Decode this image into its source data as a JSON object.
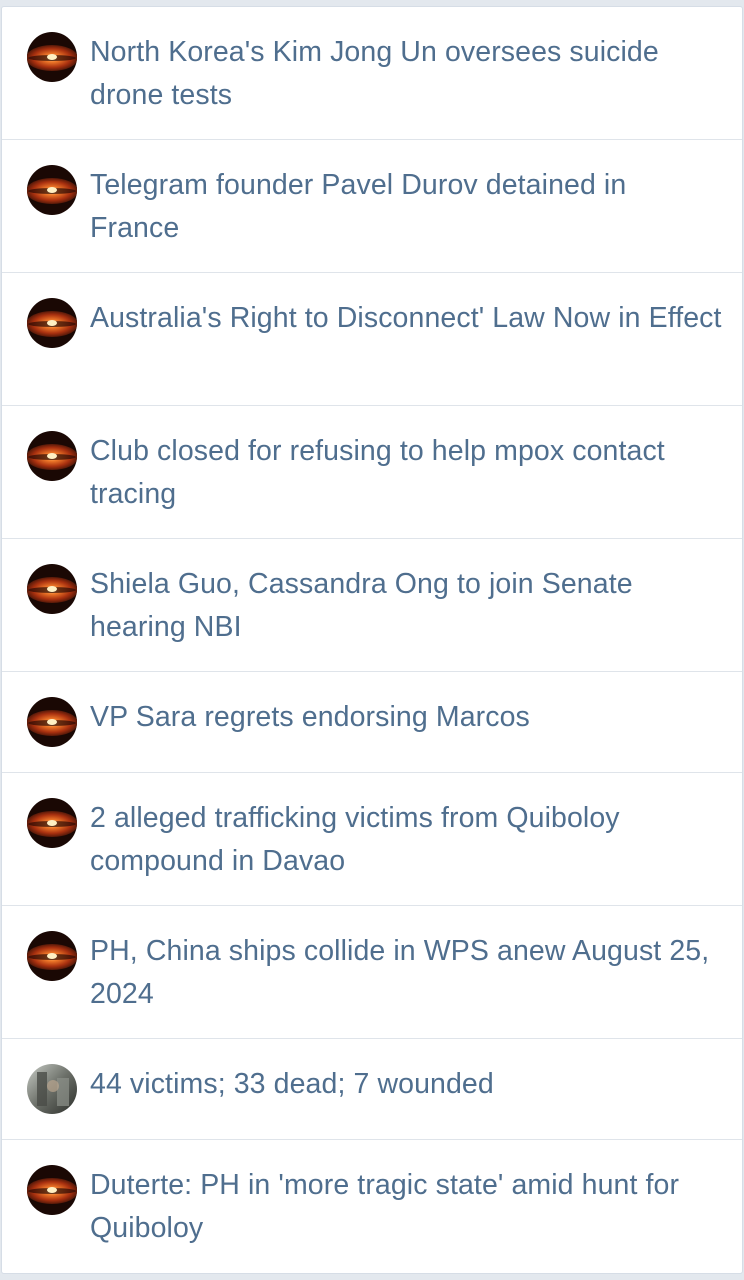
{
  "threads": [
    {
      "title": "North Korea's Kim Jong Un oversees suicide drone tests",
      "avatar": "galaxy-avatar"
    },
    {
      "title": "Telegram founder Pavel Durov detained in France",
      "avatar": "galaxy-avatar"
    },
    {
      "title": "Australia's Right to Disconnect' Law Now in Effect",
      "avatar": "galaxy-avatar"
    },
    {
      "title": "Club closed for refusing to help mpox contact tracing",
      "avatar": "galaxy-avatar"
    },
    {
      "title": "Shiela Guo, Cassandra Ong to join Senate hearing NBI",
      "avatar": "galaxy-avatar"
    },
    {
      "title": "VP Sara regrets endorsing Marcos",
      "avatar": "galaxy-avatar"
    },
    {
      "title": "2 alleged trafficking victims from Quiboloy compound in Davao",
      "avatar": "galaxy-avatar"
    },
    {
      "title": "PH, China ships collide in WPS anew August 25, 2024",
      "avatar": "galaxy-avatar"
    },
    {
      "title": "44 victims; 33 dead; 7 wounded",
      "avatar": "photo-avatar"
    },
    {
      "title": "Duterte: PH in 'more tragic state' amid hunt for Quiboloy",
      "avatar": "galaxy-avatar"
    }
  ],
  "colors": {
    "link_text": "#4f6e8e",
    "background": "#e3e8ee",
    "card": "#ffffff",
    "divider": "#dfe4ea"
  }
}
